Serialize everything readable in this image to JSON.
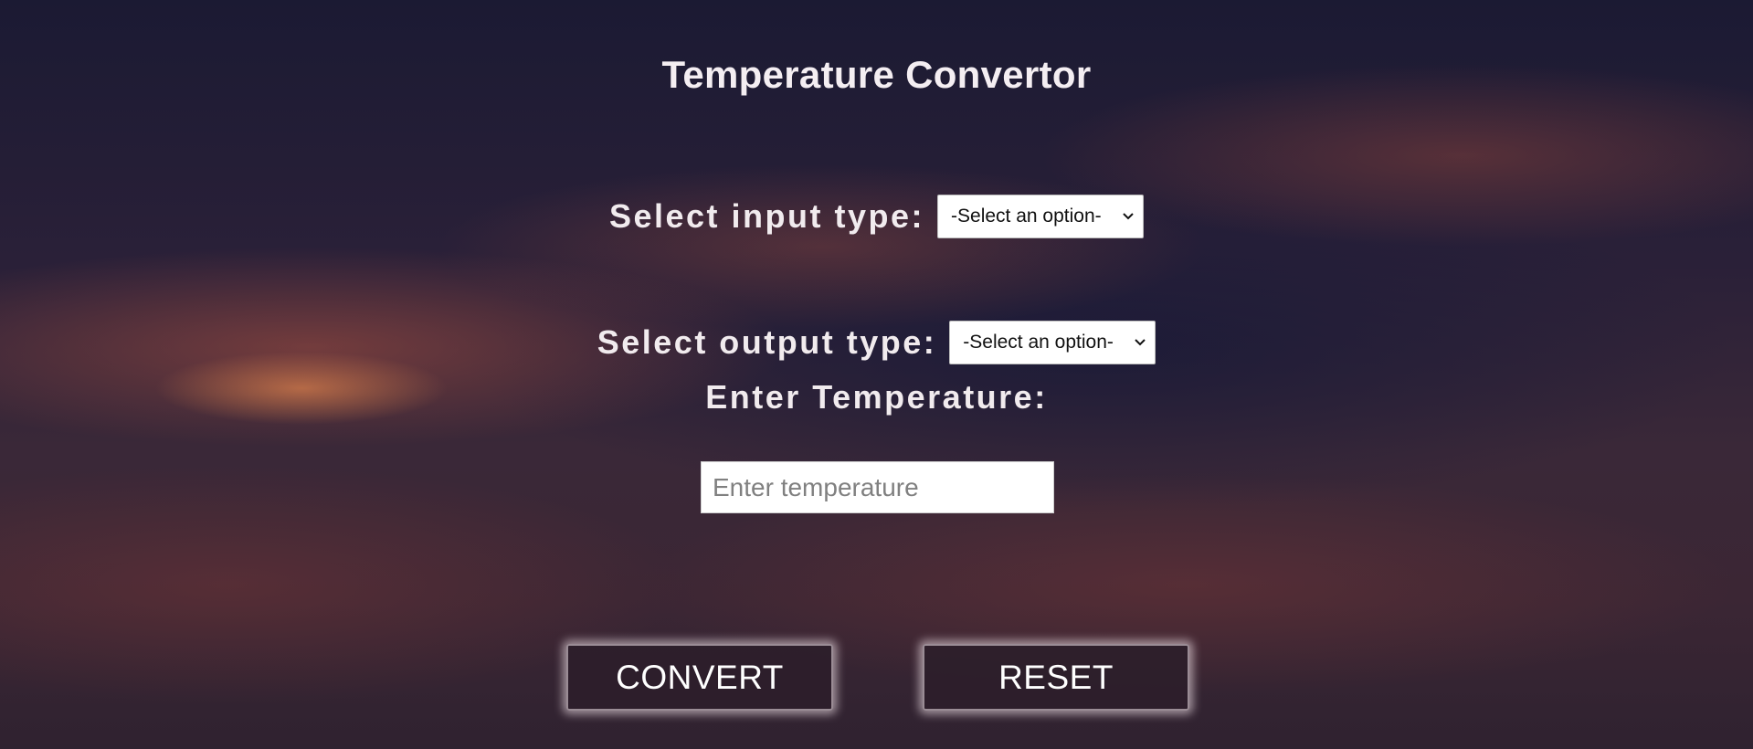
{
  "page": {
    "title": "Temperature Convertor"
  },
  "input_type": {
    "label": "Select input type:",
    "selected": "-Select an option-",
    "icon": "chevron-down-icon"
  },
  "output_type": {
    "label": "Select output type:",
    "selected": "-Select an option-",
    "icon": "chevron-down-icon"
  },
  "temperature": {
    "label": "Enter Temperature:",
    "placeholder": "Enter temperature",
    "value": ""
  },
  "actions": {
    "convert_label": "CONVERT",
    "reset_label": "RESET"
  },
  "colors": {
    "text": "#f1ebee",
    "button_bg": "#2d1e2a",
    "input_bg": "#ffffff"
  }
}
